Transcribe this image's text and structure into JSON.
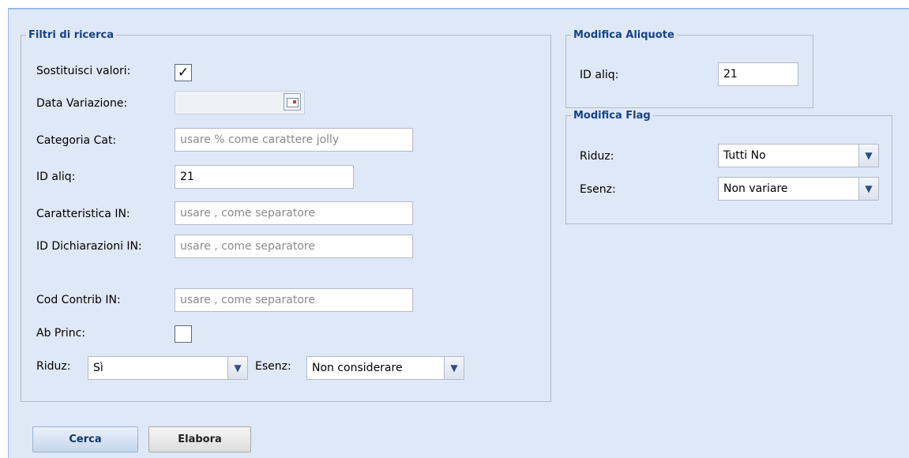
{
  "filters": {
    "legend": "Filtri di ricerca",
    "sostituisci_label": "Sostituisci valori:",
    "sostituisci_checked": true,
    "data_variazione_label": "Data Variazione:",
    "data_variazione_value": "",
    "categoria_label": "Categoria Cat:",
    "categoria_placeholder": "usare % come carattere jolly",
    "id_aliq_label": "ID aliq:",
    "id_aliq_value": "21",
    "caratteristica_label": "Caratteristica IN:",
    "caratteristica_placeholder": "usare , come separatore",
    "id_dichiarazioni_label": "ID Dichiarazioni IN:",
    "id_dichiarazioni_placeholder": "usare , come separatore",
    "cod_contrib_label": "Cod Contrib IN:",
    "cod_contrib_placeholder": "usare , come separatore",
    "ab_princ_label": "Ab Princ:",
    "ab_princ_checked": false,
    "riduz_label": "Riduz:",
    "riduz_value": "Sì",
    "esenz_label": "Esenz:",
    "esenz_value": "Non considerare"
  },
  "modifica_aliquote": {
    "legend": "Modifica Aliquote",
    "id_aliq_label": "ID aliq:",
    "id_aliq_value": "21"
  },
  "modifica_flag": {
    "legend": "Modifica Flag",
    "riduz_label": "Riduz:",
    "riduz_value": "Tutti No",
    "esenz_label": "Esenz:",
    "esenz_value": "Non variare"
  },
  "buttons": {
    "cerca": "Cerca",
    "elabora": "Elabora"
  },
  "icons": {
    "checkmark": "check-icon",
    "calendar": "calendar-icon",
    "dropdown": "chevron-down-icon"
  }
}
